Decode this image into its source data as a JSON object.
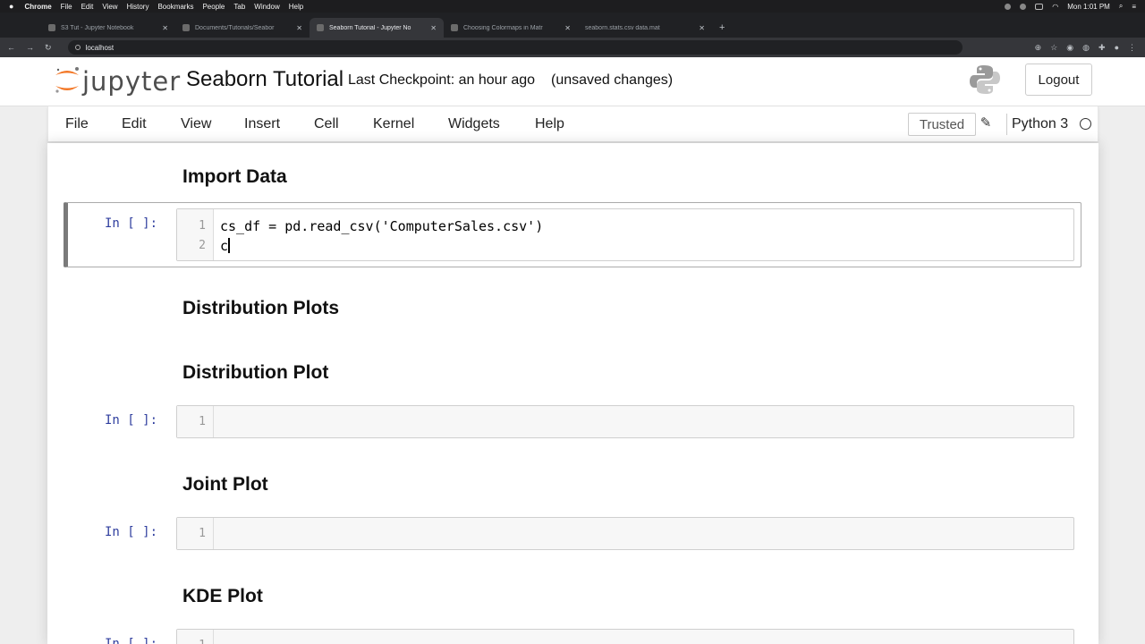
{
  "os_menubar": {
    "app": "Chrome",
    "items": [
      "File",
      "Edit",
      "View",
      "History",
      "Bookmarks",
      "People",
      "Tab",
      "Window",
      "Help"
    ],
    "clock": "Mon 1:01 PM"
  },
  "browser": {
    "tabs": [
      {
        "label": "S3 Tut - Jupyter Notebook",
        "active": false
      },
      {
        "label": "Documents/Tutorials/Seabor",
        "active": false
      },
      {
        "label": "Seaborn Tutorial - Jupyter No",
        "active": true
      },
      {
        "label": "Choosing Colormaps in Matr",
        "active": false
      },
      {
        "label": "seaborn.stats.csv data.mat",
        "active": false
      }
    ],
    "url": "localhost"
  },
  "jupyter": {
    "logo_text": "jupyter",
    "notebook_title": "Seaborn Tutorial",
    "checkpoint": "Last Checkpoint: an hour ago",
    "status": "(unsaved changes)",
    "logout_label": "Logout",
    "menu": [
      "File",
      "Edit",
      "View",
      "Insert",
      "Cell",
      "Kernel",
      "Widgets",
      "Help"
    ],
    "trusted_label": "Trusted",
    "kernel_name": "Python 3"
  },
  "cells": {
    "h_import": "Import Data",
    "prompt_label": "In [ ]:",
    "code1": {
      "line1": "cs_df = pd.read_csv('ComputerSales.csv')",
      "line2": "c",
      "ln1": "1",
      "ln2": "2"
    },
    "h_dist_plots": "Distribution Plots",
    "h_dist_plot": "Distribution Plot",
    "h_joint": "Joint Plot",
    "h_kde": "KDE Plot",
    "empty_ln": "1"
  }
}
